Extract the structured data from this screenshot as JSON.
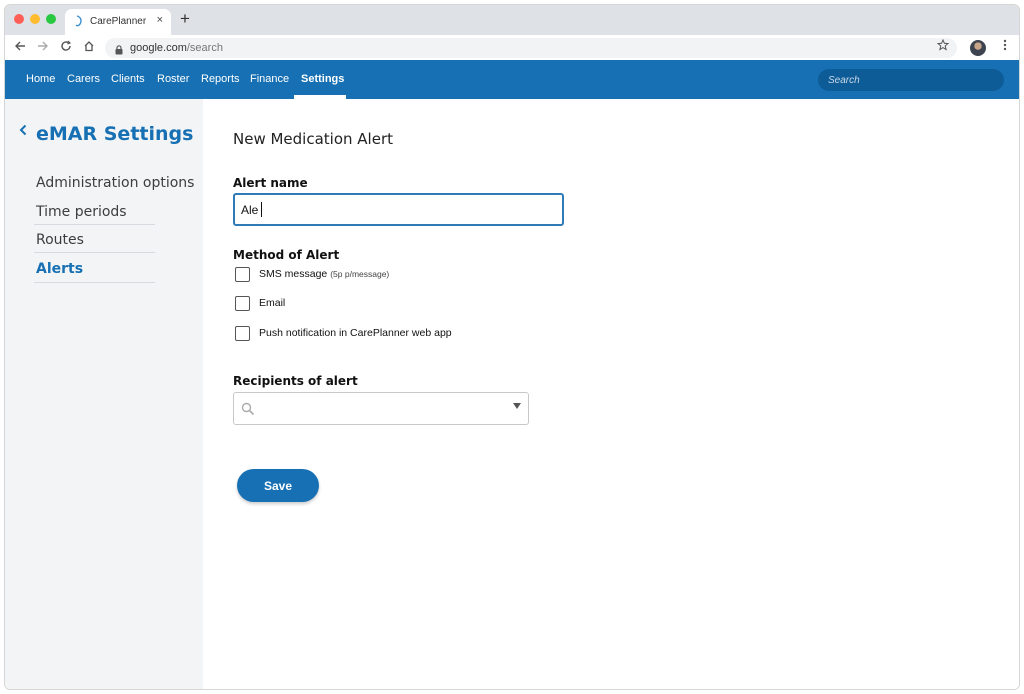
{
  "browser": {
    "tab_title": "CarePlanner",
    "tab_close_glyph": "×",
    "new_tab_glyph": "+",
    "url_host": "google.com",
    "url_path": "/search",
    "icons": [
      "back-arrow-icon",
      "forward-arrow-icon",
      "reload-icon",
      "home-icon",
      "lock-icon",
      "star-icon",
      "profile-avatar",
      "more-vert-icon"
    ]
  },
  "nav": {
    "items": [
      "Home",
      "Carers",
      "Clients",
      "Roster",
      "Reports",
      "Finance",
      "Settings"
    ],
    "active": "Settings",
    "search_placeholder": "Search",
    "brand_color": "#1670b3"
  },
  "sidebar": {
    "title": "eMAR Settings",
    "items": [
      {
        "label": "Administration options"
      },
      {
        "label": "Time periods"
      },
      {
        "label": "Routes"
      },
      {
        "label": "Alerts",
        "active": true
      }
    ]
  },
  "form": {
    "page_title": "New Medication Alert",
    "alert_name_label": "Alert name",
    "alert_name_value": "Ale",
    "method_label": "Method of Alert",
    "methods": [
      {
        "label": "SMS message",
        "note": "(5p p/message)",
        "checked": false
      },
      {
        "label": "Email",
        "note": "",
        "checked": false
      },
      {
        "label": "Push notification in CarePlanner web app",
        "note": "",
        "checked": false
      }
    ],
    "recipients_label": "Recipients of alert",
    "recipients_value": "",
    "save_label": "Save"
  }
}
